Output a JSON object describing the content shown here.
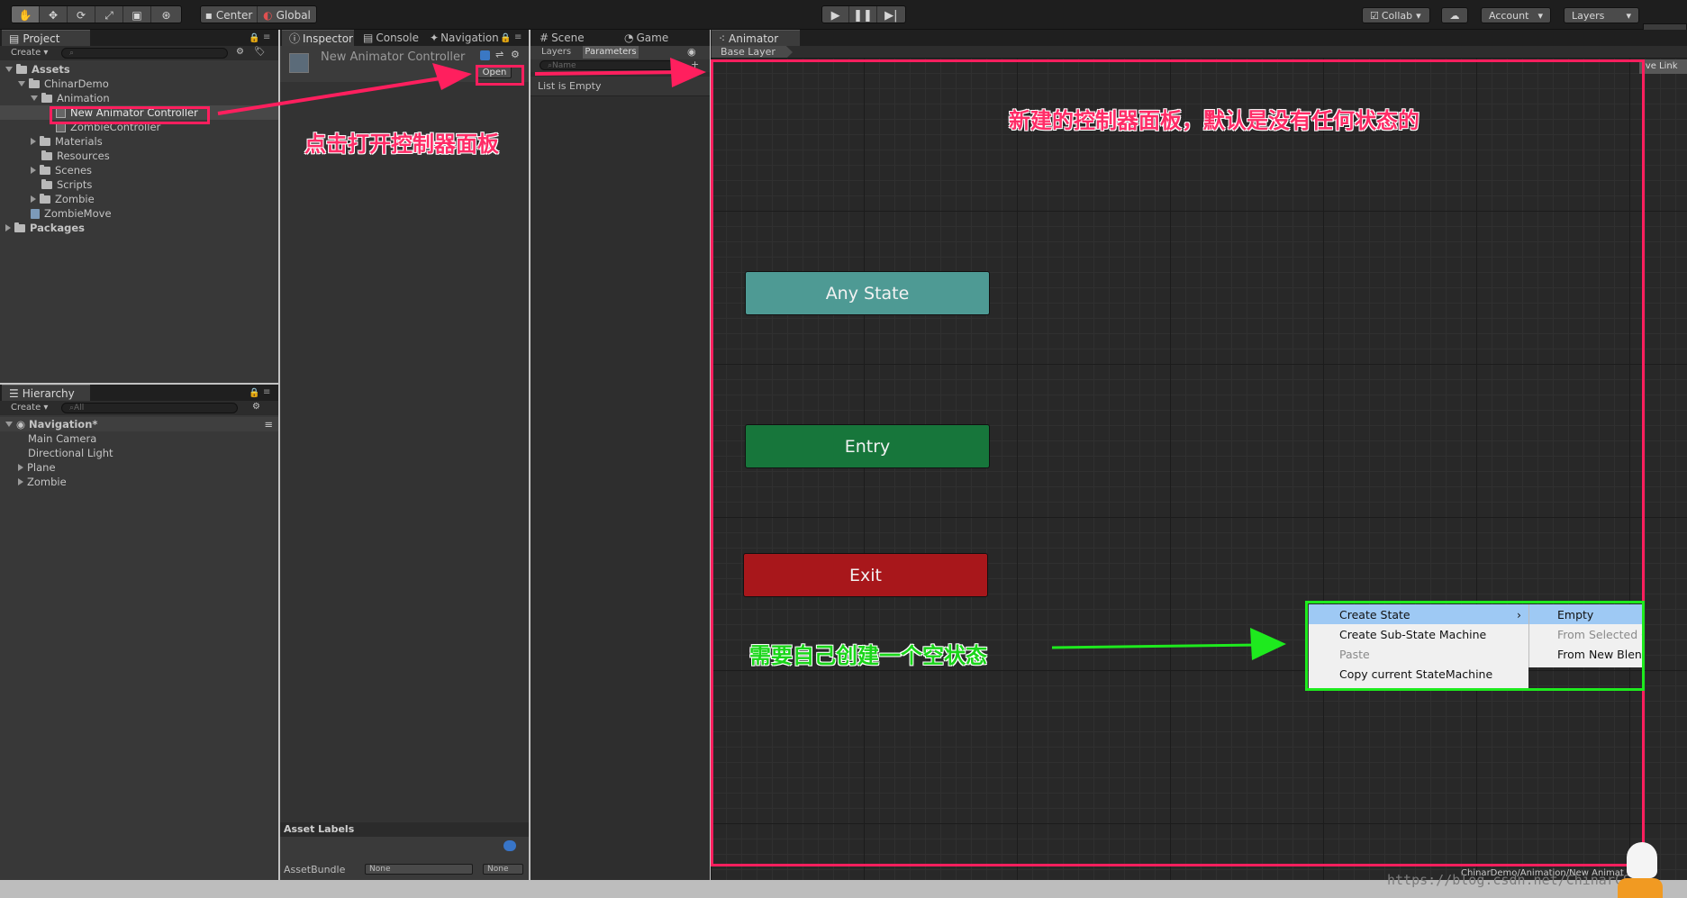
{
  "toolbar": {
    "tool_icons": [
      "hand-icon",
      "move-icon",
      "rotate-icon",
      "scale-icon",
      "rect-icon",
      "transform-icon"
    ],
    "pivot": "Center",
    "space": "Global",
    "collab": "Collab",
    "account": "Account",
    "layers": "Layers"
  },
  "project": {
    "tab": "Project",
    "create": "Create",
    "tree": [
      {
        "label": "Assets",
        "bold": true
      },
      {
        "label": "ChinarDemo"
      },
      {
        "label": "Animation"
      },
      {
        "label": "New Animator Controller"
      },
      {
        "label": "ZombieController"
      },
      {
        "label": "Materials"
      },
      {
        "label": "Resources"
      },
      {
        "label": "Scenes"
      },
      {
        "label": "Scripts"
      },
      {
        "label": "Zombie"
      },
      {
        "label": "ZombieMove"
      },
      {
        "label": "Packages",
        "bold": true
      }
    ]
  },
  "hierarchy": {
    "tab": "Hierarchy",
    "create": "Create",
    "search_placeholder": "All",
    "scene": "Navigation*",
    "items": [
      "Main Camera",
      "Directional Light",
      "Plane",
      "Zombie"
    ]
  },
  "inspector": {
    "tabs": [
      "Inspector",
      "Console",
      "Navigation"
    ],
    "object_name": "New Animator Controller",
    "open_button": "Open",
    "asset_labels": "Asset Labels",
    "asset_bundle_label": "AssetBundle",
    "asset_bundle_value": "None",
    "asset_variant_value": "None"
  },
  "params_panel": {
    "tabs": [
      "Scene",
      "Game"
    ],
    "subtabs": [
      "Layers",
      "Parameters"
    ],
    "search_placeholder": "Name",
    "empty_text": "List is Empty"
  },
  "animator": {
    "tab": "Animator",
    "breadcrumb": "Base Layer",
    "live_link": "ive Link",
    "nodes": {
      "any_state": "Any State",
      "entry": "Entry",
      "exit": "Exit"
    },
    "status_path": "ChinarDemo/Animation/New Animat"
  },
  "context_menu": {
    "items": [
      "Create State",
      "Create Sub-State Machine",
      "Paste",
      "Copy current StateMachine"
    ],
    "submenu": [
      "Empty",
      "From Selected C",
      "From New Blend"
    ]
  },
  "annotations": {
    "open_hint": "点击打开控制器面板",
    "panel_hint": "新建的控制器面板，默认是没有任何状态的",
    "create_hint": "需要自己创建一个空状态"
  },
  "watermark": "https://blog.csdn.net/ChinarCSDN",
  "colors": {
    "annotation_red": "#ff1f5e",
    "annotation_green": "#1eea1e",
    "any_state": "#4e9a94",
    "entry": "#17763b",
    "exit": "#a8171b"
  }
}
